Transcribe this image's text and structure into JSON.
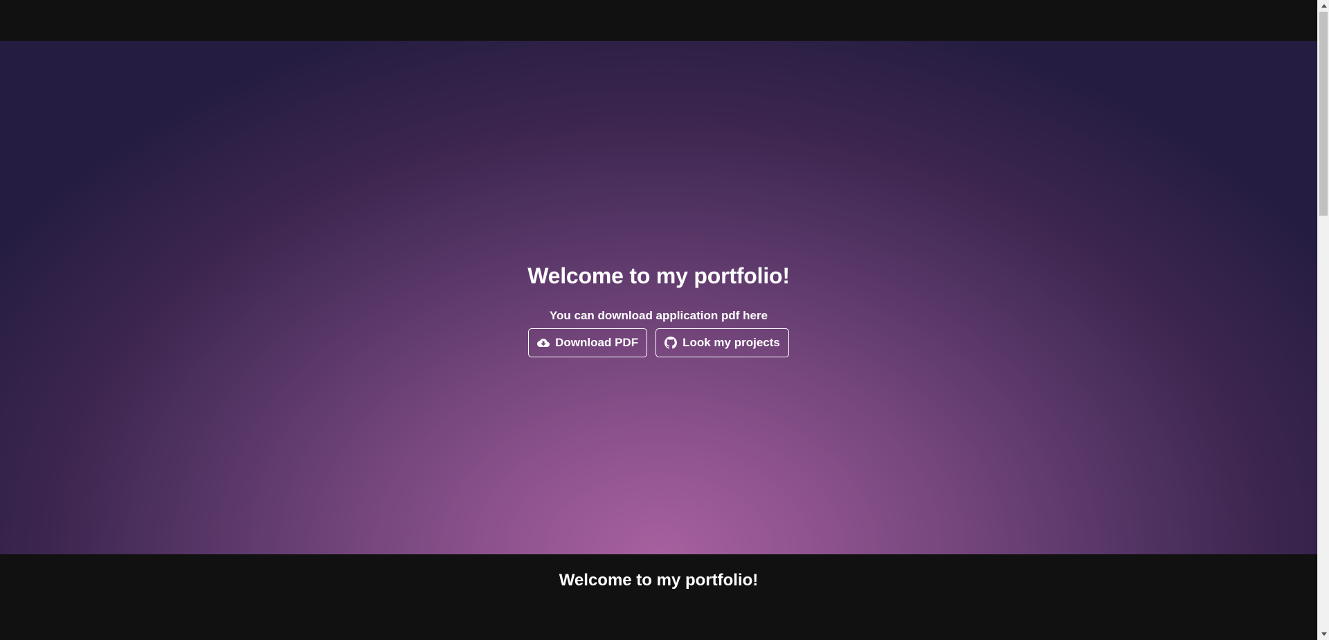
{
  "hero": {
    "title": "Welcome to my portfolio!",
    "subtitle": "You can download application pdf here",
    "buttons": [
      {
        "label": "Download PDF",
        "icon": "cloud-download-icon"
      },
      {
        "label": "Look my projects",
        "icon": "github-icon"
      }
    ]
  },
  "section": {
    "title": "Welcome to my portfolio!"
  },
  "colors": {
    "background": "#111111",
    "hero_center": "#a7609f",
    "hero_edge": "#241c41",
    "text": "#ffffff"
  }
}
